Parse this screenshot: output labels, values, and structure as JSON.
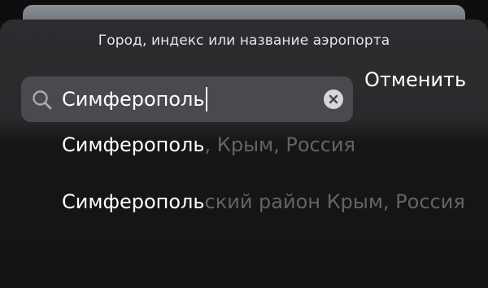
{
  "sheet": {
    "title": "Город, индекс или название аэропорта"
  },
  "search": {
    "value": "Симферополь",
    "icon": "magnifying-glass",
    "clear_icon": "x-circle"
  },
  "cancel_label": "Отменить",
  "suggestions": [
    {
      "match": "Симферополь",
      "rest": ", Крым, Россия"
    },
    {
      "match": "Симферополь",
      "rest": "ский район Крым, Россия"
    }
  ],
  "colors": {
    "sheet": "#2d2d30",
    "field": "#4a4a4e",
    "text": "#ffffff",
    "muted": "#646468"
  }
}
